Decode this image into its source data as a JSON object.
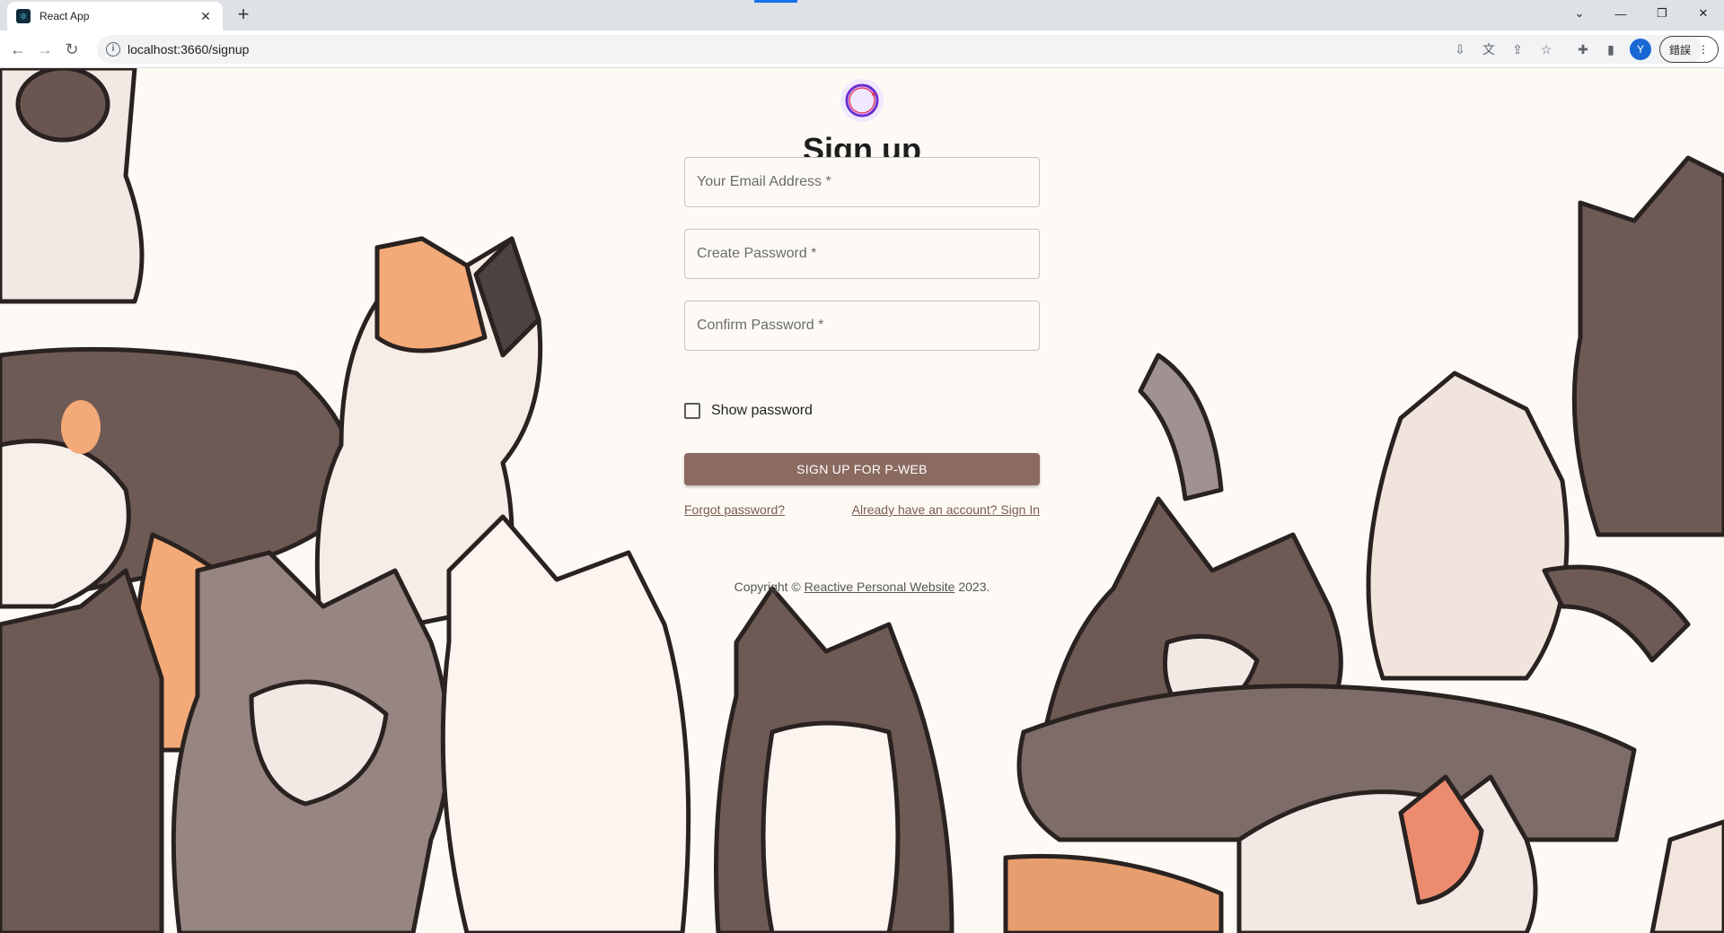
{
  "browser": {
    "tab_title": "React App",
    "tab_close": "✕",
    "new_tab": "+",
    "url": "localhost:3660/signup",
    "profile_initial": "Y",
    "update_label": "錯誤",
    "window_controls": [
      "⌄",
      "—",
      "❐",
      "✕"
    ]
  },
  "signup": {
    "title": "Sign up",
    "email_placeholder": "Your Email Address *",
    "password_placeholder": "Create Password *",
    "confirm_placeholder": "Confirm Password *",
    "show_password_label": "Show password",
    "show_password_checked": false,
    "submit_label": "SIGN UP FOR P-WEB",
    "forgot_link": "Forgot password?",
    "signin_link": "Already have an account? Sign In"
  },
  "footer": {
    "copyright_prefix": "Copyright © ",
    "site_link": "Reactive Personal Website",
    "year_suffix": " 2023."
  },
  "colors": {
    "button_bg": "#8b6a5f",
    "page_bg": "#fdfaf5",
    "link": "#7a5c52"
  }
}
